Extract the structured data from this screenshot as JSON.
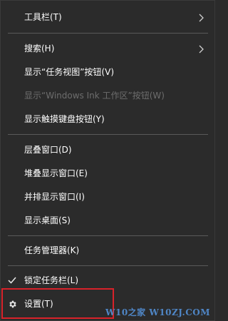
{
  "menu": {
    "toolbars": {
      "label": "工具栏(T)",
      "has_submenu": true
    },
    "search": {
      "label": "搜索(H)",
      "has_submenu": true
    },
    "show_task_view": {
      "label": "显示“任务视图”按钮(V)"
    },
    "show_ink_workspace": {
      "label": "显示“Windows Ink 工作区”按钮(W)",
      "disabled": true
    },
    "show_touch_keyboard": {
      "label": "显示触摸键盘按钮(Y)"
    },
    "cascade": {
      "label": "层叠窗口(D)"
    },
    "stacked": {
      "label": "堆叠显示窗口(E)"
    },
    "side_by_side": {
      "label": "并排显示窗口(I)"
    },
    "show_desktop": {
      "label": "显示桌面(S)"
    },
    "task_manager": {
      "label": "任务管理器(K)"
    },
    "lock_taskbar": {
      "label": "锁定任务栏(L)",
      "checked": true
    },
    "settings": {
      "label": "设置(T)",
      "icon": "gear-icon"
    }
  },
  "watermark": {
    "text": "W10之家 W10ZJ.COM"
  },
  "colors": {
    "background": "#2b2b2b",
    "separator": "#5a5a5a",
    "disabled_text": "#6d6d6d",
    "highlight_border": "#d8222a",
    "watermark": "#4f86c6"
  }
}
